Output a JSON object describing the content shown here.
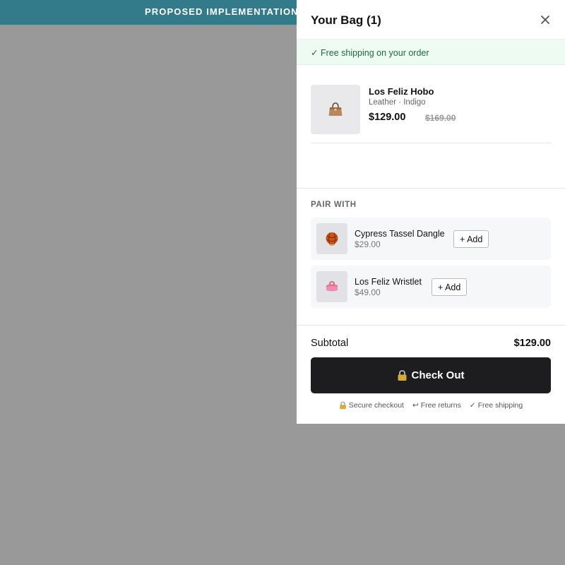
{
  "banner": {
    "text": "PROPOSED IMPLEMENTATION —"
  },
  "cart": {
    "title": "Your Bag (1)",
    "close_icon": "close-icon",
    "shipping_notice": "✓ Free shipping on your order",
    "item": {
      "name": "Los Feliz Hobo",
      "variant": "Leather · Indigo",
      "price": "$129.00",
      "compare_price": "$169.00",
      "icon": "handbag-icon"
    },
    "pair_with": {
      "heading": "PAIR WITH",
      "items": [
        {
          "name": "Cypress Tassel Dangle",
          "price": "$29.00",
          "button": "+ Add",
          "icon": "tassel-ball-icon"
        },
        {
          "name": "Los Feliz Wristlet",
          "price": "$49.00",
          "button": "+ Add",
          "icon": "purse-icon"
        }
      ]
    },
    "subtotal_label": "Subtotal",
    "subtotal_value": "$129.00",
    "checkout_label": "Check Out",
    "trust": {
      "secure": "Secure checkout",
      "returns": "↩ Free returns",
      "shipping": "✓ Free shipping"
    }
  },
  "colors": {
    "banner": "#337a8a",
    "overlay": "#999999",
    "checkout_button": "#1d1d1f",
    "shipping_bar": "#edfbf2",
    "shipping_text": "#1f6a3d"
  }
}
